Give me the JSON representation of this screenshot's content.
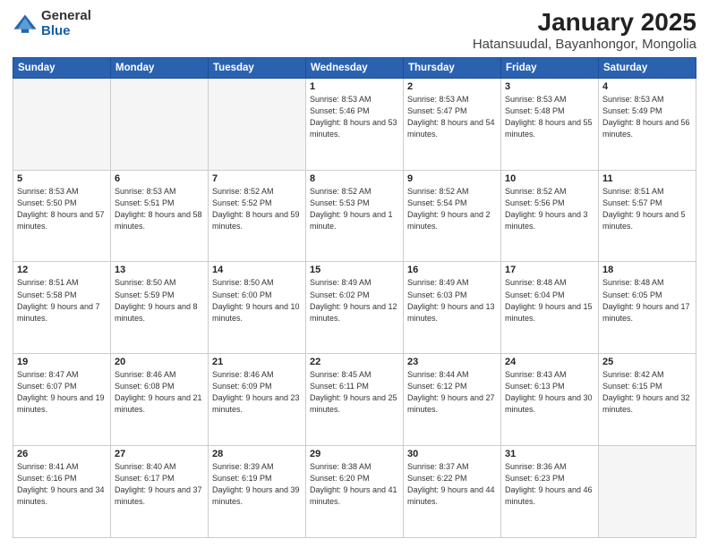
{
  "logo": {
    "general": "General",
    "blue": "Blue"
  },
  "title": "January 2025",
  "subtitle": "Hatansuudal, Bayanhongor, Mongolia",
  "weekdays": [
    "Sunday",
    "Monday",
    "Tuesday",
    "Wednesday",
    "Thursday",
    "Friday",
    "Saturday"
  ],
  "weeks": [
    [
      {
        "day": "",
        "sunrise": "",
        "sunset": "",
        "daylight": ""
      },
      {
        "day": "",
        "sunrise": "",
        "sunset": "",
        "daylight": ""
      },
      {
        "day": "",
        "sunrise": "",
        "sunset": "",
        "daylight": ""
      },
      {
        "day": "1",
        "sunrise": "Sunrise: 8:53 AM",
        "sunset": "Sunset: 5:46 PM",
        "daylight": "Daylight: 8 hours and 53 minutes."
      },
      {
        "day": "2",
        "sunrise": "Sunrise: 8:53 AM",
        "sunset": "Sunset: 5:47 PM",
        "daylight": "Daylight: 8 hours and 54 minutes."
      },
      {
        "day": "3",
        "sunrise": "Sunrise: 8:53 AM",
        "sunset": "Sunset: 5:48 PM",
        "daylight": "Daylight: 8 hours and 55 minutes."
      },
      {
        "day": "4",
        "sunrise": "Sunrise: 8:53 AM",
        "sunset": "Sunset: 5:49 PM",
        "daylight": "Daylight: 8 hours and 56 minutes."
      }
    ],
    [
      {
        "day": "5",
        "sunrise": "Sunrise: 8:53 AM",
        "sunset": "Sunset: 5:50 PM",
        "daylight": "Daylight: 8 hours and 57 minutes."
      },
      {
        "day": "6",
        "sunrise": "Sunrise: 8:53 AM",
        "sunset": "Sunset: 5:51 PM",
        "daylight": "Daylight: 8 hours and 58 minutes."
      },
      {
        "day": "7",
        "sunrise": "Sunrise: 8:52 AM",
        "sunset": "Sunset: 5:52 PM",
        "daylight": "Daylight: 8 hours and 59 minutes."
      },
      {
        "day": "8",
        "sunrise": "Sunrise: 8:52 AM",
        "sunset": "Sunset: 5:53 PM",
        "daylight": "Daylight: 9 hours and 1 minute."
      },
      {
        "day": "9",
        "sunrise": "Sunrise: 8:52 AM",
        "sunset": "Sunset: 5:54 PM",
        "daylight": "Daylight: 9 hours and 2 minutes."
      },
      {
        "day": "10",
        "sunrise": "Sunrise: 8:52 AM",
        "sunset": "Sunset: 5:56 PM",
        "daylight": "Daylight: 9 hours and 3 minutes."
      },
      {
        "day": "11",
        "sunrise": "Sunrise: 8:51 AM",
        "sunset": "Sunset: 5:57 PM",
        "daylight": "Daylight: 9 hours and 5 minutes."
      }
    ],
    [
      {
        "day": "12",
        "sunrise": "Sunrise: 8:51 AM",
        "sunset": "Sunset: 5:58 PM",
        "daylight": "Daylight: 9 hours and 7 minutes."
      },
      {
        "day": "13",
        "sunrise": "Sunrise: 8:50 AM",
        "sunset": "Sunset: 5:59 PM",
        "daylight": "Daylight: 9 hours and 8 minutes."
      },
      {
        "day": "14",
        "sunrise": "Sunrise: 8:50 AM",
        "sunset": "Sunset: 6:00 PM",
        "daylight": "Daylight: 9 hours and 10 minutes."
      },
      {
        "day": "15",
        "sunrise": "Sunrise: 8:49 AM",
        "sunset": "Sunset: 6:02 PM",
        "daylight": "Daylight: 9 hours and 12 minutes."
      },
      {
        "day": "16",
        "sunrise": "Sunrise: 8:49 AM",
        "sunset": "Sunset: 6:03 PM",
        "daylight": "Daylight: 9 hours and 13 minutes."
      },
      {
        "day": "17",
        "sunrise": "Sunrise: 8:48 AM",
        "sunset": "Sunset: 6:04 PM",
        "daylight": "Daylight: 9 hours and 15 minutes."
      },
      {
        "day": "18",
        "sunrise": "Sunrise: 8:48 AM",
        "sunset": "Sunset: 6:05 PM",
        "daylight": "Daylight: 9 hours and 17 minutes."
      }
    ],
    [
      {
        "day": "19",
        "sunrise": "Sunrise: 8:47 AM",
        "sunset": "Sunset: 6:07 PM",
        "daylight": "Daylight: 9 hours and 19 minutes."
      },
      {
        "day": "20",
        "sunrise": "Sunrise: 8:46 AM",
        "sunset": "Sunset: 6:08 PM",
        "daylight": "Daylight: 9 hours and 21 minutes."
      },
      {
        "day": "21",
        "sunrise": "Sunrise: 8:46 AM",
        "sunset": "Sunset: 6:09 PM",
        "daylight": "Daylight: 9 hours and 23 minutes."
      },
      {
        "day": "22",
        "sunrise": "Sunrise: 8:45 AM",
        "sunset": "Sunset: 6:11 PM",
        "daylight": "Daylight: 9 hours and 25 minutes."
      },
      {
        "day": "23",
        "sunrise": "Sunrise: 8:44 AM",
        "sunset": "Sunset: 6:12 PM",
        "daylight": "Daylight: 9 hours and 27 minutes."
      },
      {
        "day": "24",
        "sunrise": "Sunrise: 8:43 AM",
        "sunset": "Sunset: 6:13 PM",
        "daylight": "Daylight: 9 hours and 30 minutes."
      },
      {
        "day": "25",
        "sunrise": "Sunrise: 8:42 AM",
        "sunset": "Sunset: 6:15 PM",
        "daylight": "Daylight: 9 hours and 32 minutes."
      }
    ],
    [
      {
        "day": "26",
        "sunrise": "Sunrise: 8:41 AM",
        "sunset": "Sunset: 6:16 PM",
        "daylight": "Daylight: 9 hours and 34 minutes."
      },
      {
        "day": "27",
        "sunrise": "Sunrise: 8:40 AM",
        "sunset": "Sunset: 6:17 PM",
        "daylight": "Daylight: 9 hours and 37 minutes."
      },
      {
        "day": "28",
        "sunrise": "Sunrise: 8:39 AM",
        "sunset": "Sunset: 6:19 PM",
        "daylight": "Daylight: 9 hours and 39 minutes."
      },
      {
        "day": "29",
        "sunrise": "Sunrise: 8:38 AM",
        "sunset": "Sunset: 6:20 PM",
        "daylight": "Daylight: 9 hours and 41 minutes."
      },
      {
        "day": "30",
        "sunrise": "Sunrise: 8:37 AM",
        "sunset": "Sunset: 6:22 PM",
        "daylight": "Daylight: 9 hours and 44 minutes."
      },
      {
        "day": "31",
        "sunrise": "Sunrise: 8:36 AM",
        "sunset": "Sunset: 6:23 PM",
        "daylight": "Daylight: 9 hours and 46 minutes."
      },
      {
        "day": "",
        "sunrise": "",
        "sunset": "",
        "daylight": ""
      }
    ]
  ]
}
